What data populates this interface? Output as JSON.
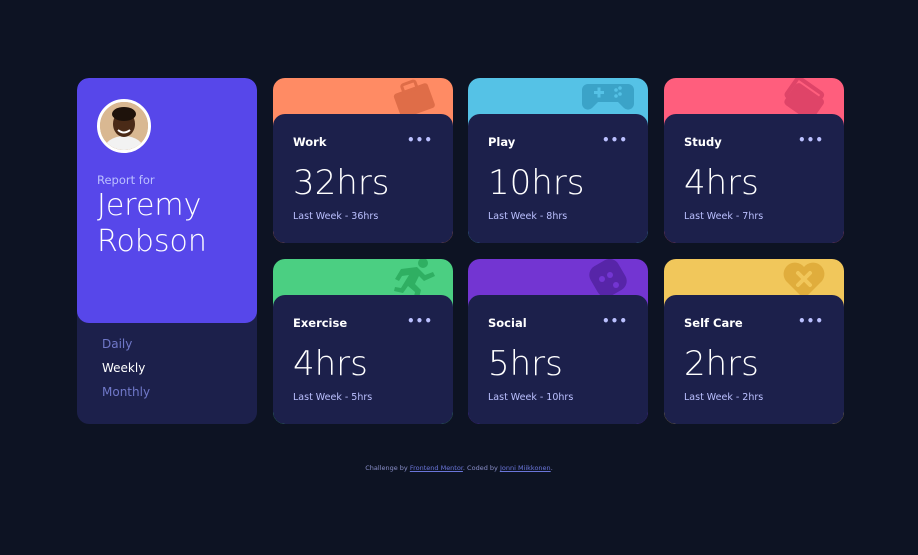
{
  "profile": {
    "report_for": "Report for",
    "name": "Jeremy Robson"
  },
  "periods": [
    "Daily",
    "Weekly",
    "Monthly"
  ],
  "active_period": "Weekly",
  "cards": [
    {
      "title": "Work",
      "current": "32hrs",
      "previous": "Last Week - 36hrs",
      "color": "#ff8b64",
      "icon": "briefcase-icon"
    },
    {
      "title": "Play",
      "current": "10hrs",
      "previous": "Last Week - 8hrs",
      "color": "#55c2e6",
      "icon": "gamepad-icon"
    },
    {
      "title": "Study",
      "current": "4hrs",
      "previous": "Last Week - 7hrs",
      "color": "#ff5e7d",
      "icon": "books-icon"
    },
    {
      "title": "Exercise",
      "current": "4hrs",
      "previous": "Last Week - 5hrs",
      "color": "#4bcf82",
      "icon": "runner-icon"
    },
    {
      "title": "Social",
      "current": "5hrs",
      "previous": "Last Week - 10hrs",
      "color": "#7335d2",
      "icon": "chat-icon"
    },
    {
      "title": "Self Care",
      "current": "2hrs",
      "previous": "Last Week - 2hrs",
      "color": "#f1c75b",
      "icon": "heart-icon"
    }
  ],
  "menu_glyph": "•••",
  "footer": {
    "prefix": "Challenge by ",
    "link1": "Frontend Mentor",
    "middle": ". Coded by ",
    "link2": "Jonni Miikkonen",
    "suffix": "."
  }
}
